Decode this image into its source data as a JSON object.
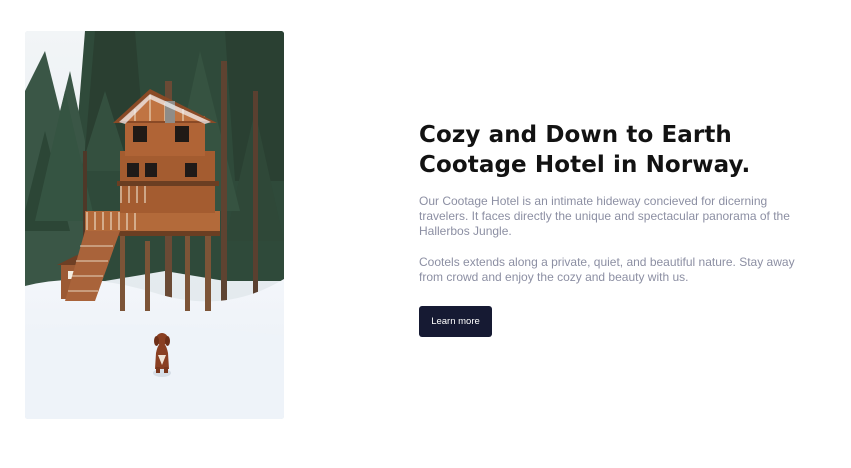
{
  "hero": {
    "image_alt": "Treehouse cabin among pine trees in snow with a dog",
    "heading": "Cozy and Down to Earth Cootage Hotel in Norway.",
    "paragraph_1": "Our Cootage Hotel is an intimate hideway concieved for dicerning travelers. It faces directly the unique and spectacular panorama of the Hallerbos Jungle.",
    "paragraph_2": "Cootels extends along a private, quiet, and beautiful nature. Stay away from crowd and enjoy the cozy and beauty with us.",
    "cta_label": "Learn more"
  },
  "colors": {
    "heading": "#121212",
    "body_text": "#8c8fa3",
    "button_bg": "#161a33",
    "button_text": "#ffffff",
    "background": "#ffffff"
  }
}
